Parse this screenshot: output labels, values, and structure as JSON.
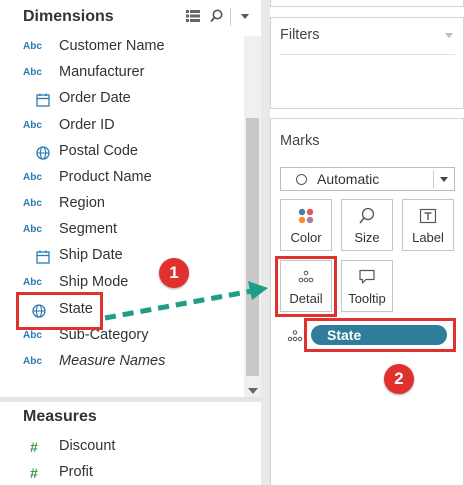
{
  "data_pane": {
    "dimensions_title": "Dimensions",
    "dimensions": [
      {
        "icon": "abc",
        "text": "Abc",
        "label": "Customer Name"
      },
      {
        "icon": "abc",
        "text": "Abc",
        "label": "Manufacturer"
      },
      {
        "icon": "calendar",
        "text": "",
        "label": "Order Date"
      },
      {
        "icon": "abc",
        "text": "Abc",
        "label": "Order ID"
      },
      {
        "icon": "globe",
        "text": "",
        "label": "Postal Code"
      },
      {
        "icon": "abc",
        "text": "Abc",
        "label": "Product Name"
      },
      {
        "icon": "abc",
        "text": "Abc",
        "label": "Region"
      },
      {
        "icon": "abc",
        "text": "Abc",
        "label": "Segment"
      },
      {
        "icon": "calendar",
        "text": "",
        "label": "Ship Date"
      },
      {
        "icon": "abc",
        "text": "Abc",
        "label": "Ship Mode"
      },
      {
        "icon": "globe",
        "text": "",
        "label": "State"
      },
      {
        "icon": "abc",
        "text": "Abc",
        "label": "Sub-Category"
      },
      {
        "icon": "abc",
        "text": "Abc",
        "label": "Measure Names"
      }
    ],
    "measures_title": "Measures",
    "measures": [
      {
        "icon_text": "#",
        "label": "Discount"
      },
      {
        "icon_text": "#",
        "label": "Profit"
      }
    ]
  },
  "filters": {
    "title": "Filters"
  },
  "marks": {
    "title": "Marks",
    "mark_type": "Automatic",
    "buttons": {
      "color": "Color",
      "size": "Size",
      "label": "Label",
      "detail": "Detail",
      "tooltip": "Tooltip"
    },
    "pill_label": "State"
  },
  "annotations": {
    "badge_1": "1",
    "badge_2": "2"
  },
  "colors": {
    "accent_red": "#e0312f",
    "arrow_teal": "#1e9e84",
    "pill_blue": "#2f7d9a",
    "field_blue": "#2b7bb3",
    "measure_green": "#3a9a4a"
  }
}
